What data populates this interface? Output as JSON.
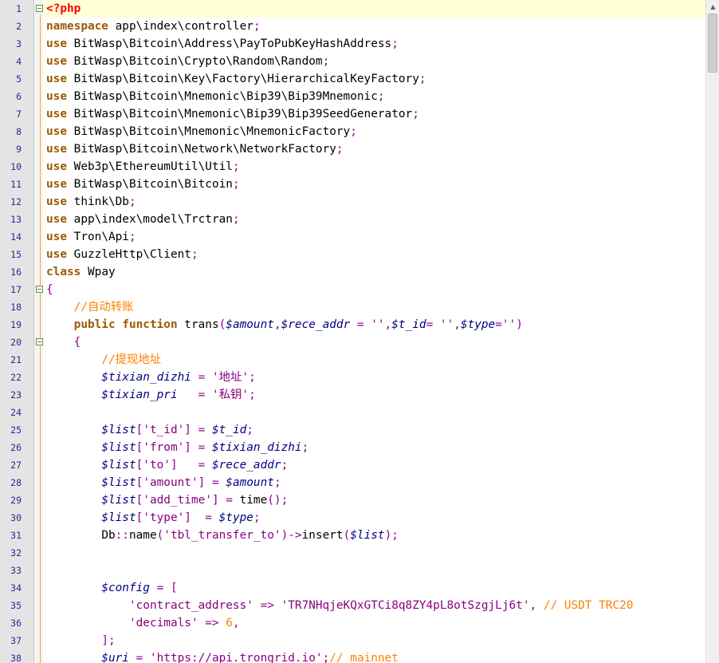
{
  "lines": [
    [
      {
        "t": "<?php",
        "c": "tag"
      }
    ],
    [
      {
        "t": "namespace",
        "c": "kw"
      },
      {
        "t": " app\\index\\controller"
      },
      {
        "t": ";",
        "c": "op"
      }
    ],
    [
      {
        "t": "use",
        "c": "kw"
      },
      {
        "t": " BitWasp\\Bitcoin\\Address\\PayToPubKeyHashAddress"
      },
      {
        "t": ";",
        "c": "op"
      }
    ],
    [
      {
        "t": "use",
        "c": "kw"
      },
      {
        "t": " BitWasp\\Bitcoin\\Crypto\\Random\\Random"
      },
      {
        "t": ";",
        "c": "op"
      }
    ],
    [
      {
        "t": "use",
        "c": "kw"
      },
      {
        "t": " BitWasp\\Bitcoin\\Key\\Factory\\HierarchicalKeyFactory"
      },
      {
        "t": ";",
        "c": "op"
      }
    ],
    [
      {
        "t": "use",
        "c": "kw"
      },
      {
        "t": " BitWasp\\Bitcoin\\Mnemonic\\Bip39\\Bip39Mnemonic"
      },
      {
        "t": ";",
        "c": "op"
      }
    ],
    [
      {
        "t": "use",
        "c": "kw"
      },
      {
        "t": " BitWasp\\Bitcoin\\Mnemonic\\Bip39\\Bip39SeedGenerator"
      },
      {
        "t": ";",
        "c": "op"
      }
    ],
    [
      {
        "t": "use",
        "c": "kw"
      },
      {
        "t": " BitWasp\\Bitcoin\\Mnemonic\\MnemonicFactory"
      },
      {
        "t": ";",
        "c": "op"
      }
    ],
    [
      {
        "t": "use",
        "c": "kw"
      },
      {
        "t": " BitWasp\\Bitcoin\\Network\\NetworkFactory"
      },
      {
        "t": ";",
        "c": "op"
      }
    ],
    [
      {
        "t": "use",
        "c": "kw"
      },
      {
        "t": " Web3p\\EthereumUtil\\Util"
      },
      {
        "t": ";",
        "c": "op"
      }
    ],
    [
      {
        "t": "use",
        "c": "kw"
      },
      {
        "t": " BitWasp\\Bitcoin\\Bitcoin"
      },
      {
        "t": ";",
        "c": "op"
      }
    ],
    [
      {
        "t": "use",
        "c": "kw"
      },
      {
        "t": " think\\Db"
      },
      {
        "t": ";",
        "c": "op"
      }
    ],
    [
      {
        "t": "use",
        "c": "kw"
      },
      {
        "t": " app\\index\\model\\Trctran"
      },
      {
        "t": ";",
        "c": "op"
      }
    ],
    [
      {
        "t": "use",
        "c": "kw"
      },
      {
        "t": " Tron\\Api"
      },
      {
        "t": ";",
        "c": "op"
      }
    ],
    [
      {
        "t": "use",
        "c": "kw"
      },
      {
        "t": " GuzzleHttp\\Client"
      },
      {
        "t": ";",
        "c": "op"
      }
    ],
    [
      {
        "t": "class",
        "c": "kw"
      },
      {
        "t": " Wpay"
      }
    ],
    [
      {
        "t": "{",
        "c": "op"
      }
    ],
    [
      {
        "t": "    "
      },
      {
        "t": "//自动转账",
        "c": "c"
      }
    ],
    [
      {
        "t": "    "
      },
      {
        "t": "public",
        "c": "kw"
      },
      {
        "t": " "
      },
      {
        "t": "function",
        "c": "kw"
      },
      {
        "t": " trans"
      },
      {
        "t": "(",
        "c": "op"
      },
      {
        "t": "$amount",
        "c": "v"
      },
      {
        "t": ",",
        "c": "op"
      },
      {
        "t": "$rece_addr",
        "c": "v"
      },
      {
        "t": " = ",
        "c": "op"
      },
      {
        "t": "''",
        "c": "s"
      },
      {
        "t": ",",
        "c": "op"
      },
      {
        "t": "$t_id",
        "c": "v"
      },
      {
        "t": "= ",
        "c": "op"
      },
      {
        "t": "''",
        "c": "s"
      },
      {
        "t": ",",
        "c": "op"
      },
      {
        "t": "$type",
        "c": "v"
      },
      {
        "t": "=",
        "c": "op"
      },
      {
        "t": "''",
        "c": "s"
      },
      {
        "t": ")",
        "c": "op"
      }
    ],
    [
      {
        "t": "    "
      },
      {
        "t": "{",
        "c": "op"
      }
    ],
    [
      {
        "t": "        "
      },
      {
        "t": "//提现地址",
        "c": "c"
      }
    ],
    [
      {
        "t": "        "
      },
      {
        "t": "$tixian_dizhi",
        "c": "v"
      },
      {
        "t": " = ",
        "c": "op"
      },
      {
        "t": "'地址'",
        "c": "s"
      },
      {
        "t": ";",
        "c": "op"
      }
    ],
    [
      {
        "t": "        "
      },
      {
        "t": "$tixian_pri",
        "c": "v"
      },
      {
        "t": "   = ",
        "c": "op"
      },
      {
        "t": "'私钥'",
        "c": "s"
      },
      {
        "t": ";",
        "c": "op"
      }
    ],
    [],
    [
      {
        "t": "        "
      },
      {
        "t": "$list",
        "c": "v"
      },
      {
        "t": "[",
        "c": "op"
      },
      {
        "t": "'t_id'",
        "c": "s"
      },
      {
        "t": "] = ",
        "c": "op"
      },
      {
        "t": "$t_id",
        "c": "v"
      },
      {
        "t": ";",
        "c": "op"
      }
    ],
    [
      {
        "t": "        "
      },
      {
        "t": "$list",
        "c": "v"
      },
      {
        "t": "[",
        "c": "op"
      },
      {
        "t": "'from'",
        "c": "s"
      },
      {
        "t": "] = ",
        "c": "op"
      },
      {
        "t": "$tixian_dizhi",
        "c": "v"
      },
      {
        "t": ";",
        "c": "op"
      }
    ],
    [
      {
        "t": "        "
      },
      {
        "t": "$list",
        "c": "v"
      },
      {
        "t": "[",
        "c": "op"
      },
      {
        "t": "'to'",
        "c": "s"
      },
      {
        "t": "]   = ",
        "c": "op"
      },
      {
        "t": "$rece_addr",
        "c": "v"
      },
      {
        "t": ";",
        "c": "op"
      }
    ],
    [
      {
        "t": "        "
      },
      {
        "t": "$list",
        "c": "v"
      },
      {
        "t": "[",
        "c": "op"
      },
      {
        "t": "'amount'",
        "c": "s"
      },
      {
        "t": "] = ",
        "c": "op"
      },
      {
        "t": "$amount",
        "c": "v"
      },
      {
        "t": ";",
        "c": "op"
      }
    ],
    [
      {
        "t": "        "
      },
      {
        "t": "$list",
        "c": "v"
      },
      {
        "t": "[",
        "c": "op"
      },
      {
        "t": "'add_time'",
        "c": "s"
      },
      {
        "t": "] = ",
        "c": "op"
      },
      {
        "t": "time"
      },
      {
        "t": "();",
        "c": "op"
      }
    ],
    [
      {
        "t": "        "
      },
      {
        "t": "$list",
        "c": "v"
      },
      {
        "t": "[",
        "c": "op"
      },
      {
        "t": "'type'",
        "c": "s"
      },
      {
        "t": "]  = ",
        "c": "op"
      },
      {
        "t": "$type",
        "c": "v"
      },
      {
        "t": ";",
        "c": "op"
      }
    ],
    [
      {
        "t": "        "
      },
      {
        "t": "Db"
      },
      {
        "t": "::",
        "c": "op"
      },
      {
        "t": "name"
      },
      {
        "t": "(",
        "c": "op"
      },
      {
        "t": "'tbl_transfer_to'",
        "c": "s"
      },
      {
        "t": ")->",
        "c": "op"
      },
      {
        "t": "insert"
      },
      {
        "t": "(",
        "c": "op"
      },
      {
        "t": "$list",
        "c": "v"
      },
      {
        "t": ");",
        "c": "op"
      }
    ],
    [],
    [],
    [
      {
        "t": "        "
      },
      {
        "t": "$config",
        "c": "v"
      },
      {
        "t": " = [",
        "c": "op"
      }
    ],
    [
      {
        "t": "            "
      },
      {
        "t": "'contract_address'",
        "c": "s"
      },
      {
        "t": " => ",
        "c": "op"
      },
      {
        "t": "'TR7NHqjeKQxGTCi8q8ZY4pL8otSzgjLj6t'",
        "c": "s"
      },
      {
        "t": ", ",
        "c": "op"
      },
      {
        "t": "// USDT TRC20",
        "c": "c"
      }
    ],
    [
      {
        "t": "            "
      },
      {
        "t": "'decimals'",
        "c": "s"
      },
      {
        "t": " => ",
        "c": "op"
      },
      {
        "t": "6",
        "c": "c"
      },
      {
        "t": ",",
        "c": "op"
      }
    ],
    [
      {
        "t": "        "
      },
      {
        "t": "];",
        "c": "op"
      }
    ],
    [
      {
        "t": "        "
      },
      {
        "t": "$uri",
        "c": "v"
      },
      {
        "t": " = ",
        "c": "op"
      },
      {
        "t": "'https://api.trongrid.io'",
        "c": "s"
      },
      {
        "t": ";",
        "c": "op"
      },
      {
        "t": "// mainnet",
        "c": "c"
      }
    ]
  ],
  "editor": {
    "first_line_number": 1,
    "current_line": 1,
    "fold_markers_at_lines": [
      1,
      17,
      20
    ]
  },
  "scrollbar": {
    "up_arrow": "▲",
    "position_fraction": 0.0
  }
}
